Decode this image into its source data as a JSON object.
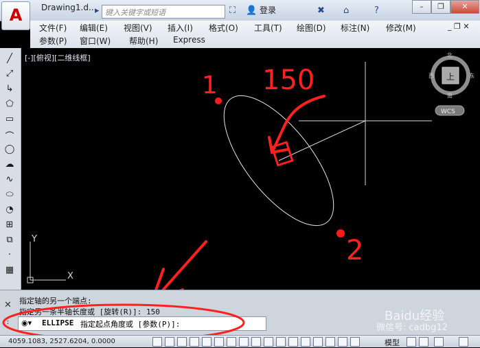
{
  "app": {
    "title": "Drawing1.d..."
  },
  "search": {
    "placeholder": "键入关键字或短语"
  },
  "login_label": "登录",
  "menu_row1": [
    "文件(F)",
    "编辑(E)",
    "视图(V)",
    "插入(I)",
    "格式(O)",
    "工具(T)",
    "绘图(D)",
    "标注(N)",
    "修改(M)"
  ],
  "menu_row2": [
    "参数(P)",
    "窗口(W)",
    "帮助(H)",
    "Express"
  ],
  "view_label": "[-][俯视][二维线框]",
  "viewcube": {
    "north": "北",
    "south": "南",
    "east": "东",
    "west": "西",
    "face": "上",
    "wcs": "WCS"
  },
  "ucs": {
    "x": "X",
    "y": "Y"
  },
  "annotations": {
    "point1": "1",
    "point2": "2",
    "dimension": "150"
  },
  "command": {
    "line1": "指定轴的另一个端点:",
    "line2": "指定另一条半轴长度或 [旋转(R)]: 150",
    "current_cmd": "ELLIPSE",
    "prompt_text": "指定起点角度或 [参数(P)]:"
  },
  "status": {
    "coords": "4059.1083, 2527.6204, 0.0000",
    "model": "模型"
  },
  "watermark": {
    "baidu": "Baidu经验",
    "wechat": "微信号: cadbg12"
  }
}
